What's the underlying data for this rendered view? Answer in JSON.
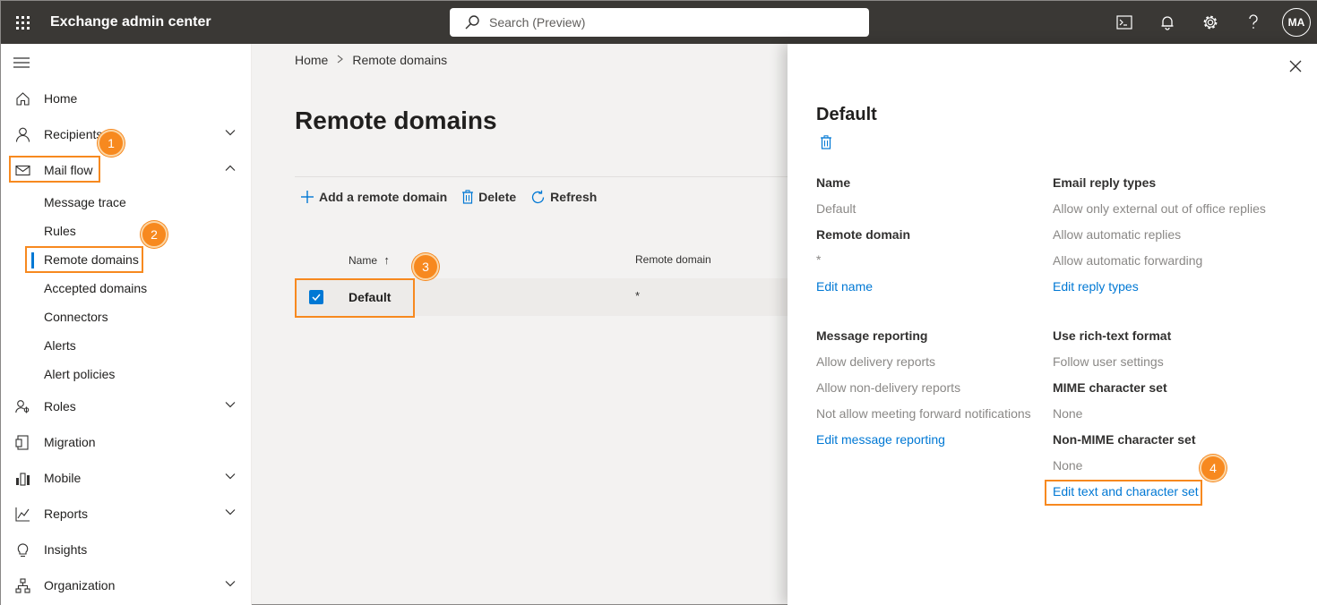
{
  "app": {
    "title": "Exchange admin center"
  },
  "search": {
    "placeholder": "Search (Preview)"
  },
  "user": {
    "initials": "MA"
  },
  "sidebar": {
    "items": [
      {
        "label": "Home",
        "icon": "home-icon"
      },
      {
        "label": "Recipients",
        "icon": "person-icon"
      },
      {
        "label": "Mail flow",
        "icon": "mail-icon"
      },
      {
        "label": "Roles",
        "icon": "roles-icon"
      },
      {
        "label": "Migration",
        "icon": "migration-icon"
      },
      {
        "label": "Mobile",
        "icon": "mobile-icon"
      },
      {
        "label": "Reports",
        "icon": "reports-icon"
      },
      {
        "label": "Insights",
        "icon": "lightbulb-icon"
      },
      {
        "label": "Organization",
        "icon": "organization-icon"
      }
    ],
    "mailflow_sub": [
      "Message trace",
      "Rules",
      "Remote domains",
      "Accepted domains",
      "Connectors",
      "Alerts",
      "Alert policies"
    ]
  },
  "breadcrumb": {
    "home": "Home",
    "current": "Remote domains"
  },
  "main": {
    "title": "Remote domains",
    "toolbar": {
      "add": "Add a remote domain",
      "delete": "Delete",
      "refresh": "Refresh"
    },
    "columns": {
      "name": "Name",
      "sort_arrow": "↑",
      "domain": "Remote domain"
    },
    "rows": [
      {
        "name": "Default",
        "domain": "*"
      }
    ]
  },
  "panel": {
    "title": "Default",
    "name_label": "Name",
    "name_value": "Default",
    "remote_domain_label": "Remote domain",
    "remote_domain_value": "*",
    "edit_name": "Edit name",
    "email_reply_label": "Email reply types",
    "reply_values": [
      "Allow only external out of office replies",
      "Allow automatic replies",
      "Allow automatic forwarding"
    ],
    "edit_reply": "Edit reply types",
    "message_reporting_label": "Message reporting",
    "reporting_values": [
      "Allow delivery reports",
      "Allow non-delivery reports",
      "Not allow meeting forward notifications"
    ],
    "edit_reporting": "Edit message reporting",
    "rich_text_label": "Use rich-text format",
    "rich_text_value": "Follow user settings",
    "mime_label": "MIME character set",
    "mime_value": "None",
    "non_mime_label": "Non-MIME character set",
    "non_mime_value": "None",
    "edit_text": "Edit text and character set"
  },
  "annotations": [
    "1",
    "2",
    "3",
    "4"
  ],
  "colors": {
    "accent": "#0078d4",
    "topbar": "#3a3835",
    "callout": "#f7891f"
  }
}
